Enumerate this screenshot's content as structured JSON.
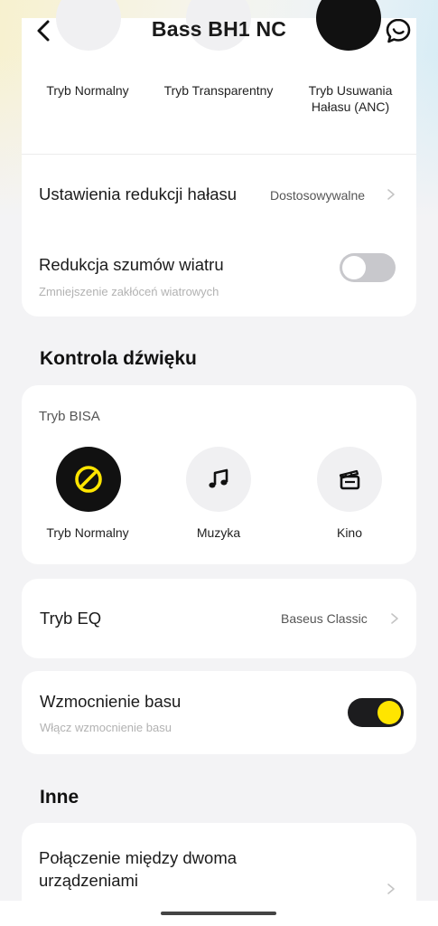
{
  "header": {
    "title": "Bass BH1 NC"
  },
  "anc_modes": {
    "items": [
      {
        "label": "Tryb Normalny"
      },
      {
        "label": "Tryb Transparentny"
      },
      {
        "label": "Tryb Usuwania Hałasu (ANC)"
      }
    ],
    "line1_3": "Tryb Usuwania",
    "line2_3": "Hałasu (ANC)"
  },
  "noise_settings": {
    "title": "Ustawienia redukcji hałasu",
    "value": "Dostosowywalne"
  },
  "wind_reduction": {
    "title": "Redukcja szumów wiatru",
    "subtitle": "Zmniejszenie zakłóceń wiatrowych",
    "enabled": false
  },
  "sound_control": {
    "heading": "Kontrola dźwięku",
    "bisa_label": "Tryb BISA",
    "bisa_modes": [
      {
        "label": "Tryb Normalny",
        "icon": "no-entry-icon",
        "selected": true
      },
      {
        "label": "Muzyka",
        "icon": "music-note-icon",
        "selected": false
      },
      {
        "label": "Kino",
        "icon": "clapperboard-icon",
        "selected": false
      }
    ]
  },
  "eq": {
    "title": "Tryb EQ",
    "value": "Baseus Classic"
  },
  "bass_boost": {
    "title": "Wzmocnienie basu",
    "subtitle": "Włącz wzmocnienie basu",
    "enabled": true
  },
  "other": {
    "heading": "Inne",
    "dual_connection_line1": "Połączenie między dwoma",
    "dual_connection_line2": "urządzeniami"
  },
  "colors": {
    "accent": "#ffe500",
    "dark": "#111111",
    "toggle_off": "#c8c8cc",
    "background": "#f3f3f5"
  }
}
